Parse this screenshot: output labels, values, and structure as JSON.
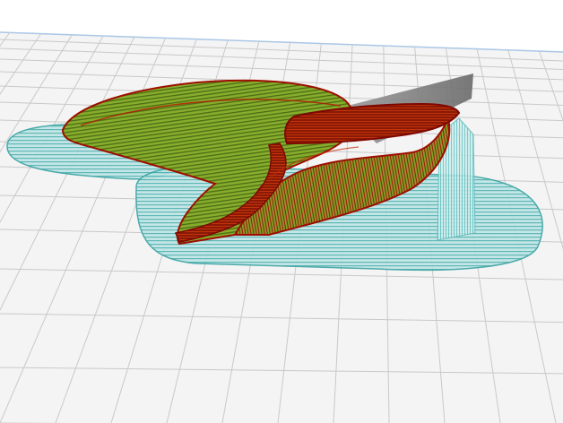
{
  "viewport": {
    "background": "#ffffff",
    "build_plate_color": "#f4f4f4",
    "grid_line_color": "#c9c9c9",
    "plate_edge_color": "#a9c7e6"
  },
  "preview": {
    "layer_colors": {
      "brim_support": "#58b8b8",
      "infill": "#8fb830",
      "shell": "#5d7a1c",
      "outer_wall": "#b00000",
      "travel_shadow": "#8a8a8a"
    },
    "objects": [
      {
        "name": "sliced-model",
        "type": "gcode-layer-preview"
      },
      {
        "name": "support-structure",
        "type": "support"
      },
      {
        "name": "brim-skirt",
        "type": "brim"
      }
    ]
  }
}
